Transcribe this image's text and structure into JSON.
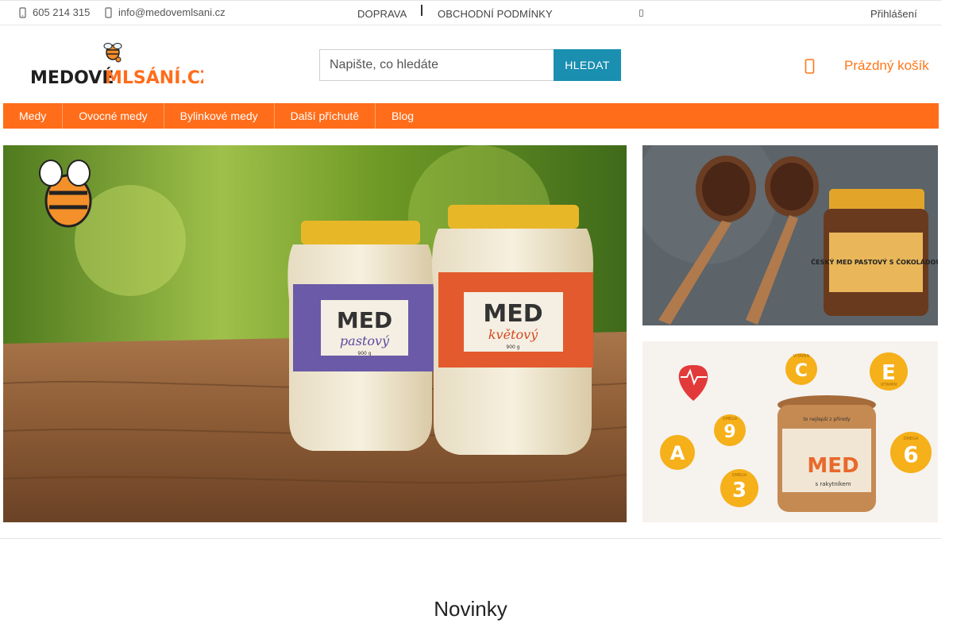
{
  "topbar": {
    "phone": "605 214 315",
    "email": "info@medovemlsani.cz",
    "links": [
      "DOPRAVA",
      "OBCHODNÍ PODMÍNKY"
    ],
    "login": "Přihlášení"
  },
  "header": {
    "logo": {
      "line1": "MEDOVÉ",
      "line2": "MLSÁNÍ.CZ",
      "accent": "#ff6d1a"
    },
    "search": {
      "placeholder": "Napište, co hledáte",
      "button": "HLEDAT"
    },
    "cart": {
      "label": "Prázdný košík",
      "icon": "cart-icon"
    }
  },
  "nav": {
    "items": [
      "Medy",
      "Ovocné medy",
      "Bylinkové medy",
      "Další příchutě",
      "Blog"
    ]
  },
  "banners": {
    "main": {
      "jar1_label": "MED",
      "jar1_sub": "pastový",
      "jar1_weight": "900 g",
      "jar2_label": "MED",
      "jar2_sub": "květový",
      "jar2_weight": "900 g"
    },
    "top": {
      "jar_label": "ČESKÝ MED PASTOVÝ S ČOKOLÁDOU"
    },
    "bottom": {
      "vitamin_c": "C",
      "vitamin_e": "E",
      "vitamin_a": "A",
      "omega9": "9",
      "omega3": "3",
      "omega6": "6",
      "vitamin_word": "VITAMIN",
      "omega_word": "OMEGA",
      "jar_label": "MED",
      "jar_sub": "s rakytníkem",
      "jar_top": "to nejlepší z přírody"
    }
  },
  "colors": {
    "brand_orange": "#ff6d1a",
    "search_button": "#1a8fb0",
    "cart_text": "#ff7618"
  },
  "section": {
    "title": "Novinky"
  }
}
